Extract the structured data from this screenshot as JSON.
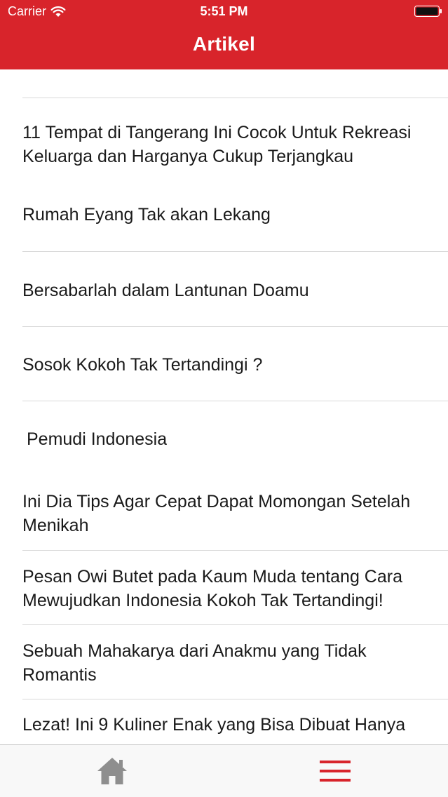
{
  "status_bar": {
    "carrier": "Carrier",
    "time": "5:51 PM"
  },
  "nav": {
    "title": "Artikel"
  },
  "articles": [
    {
      "title": "11 Tempat di Tangerang Ini Cocok Untuk Rekreasi Keluarga dan Harganya Cukup Terjangkau"
    },
    {
      "title": "Rumah Eyang Tak akan Lekang"
    },
    {
      "title": "Bersabarlah dalam Lantunan Doamu"
    },
    {
      "title": "Sosok Kokoh Tak Tertandingi ?"
    },
    {
      "title": "Pemudi Indonesia"
    },
    {
      "title": "Ini Dia Tips Agar Cepat Dapat Momongan Setelah Menikah"
    },
    {
      "title": "Pesan Owi Butet pada Kaum Muda tentang Cara Mewujudkan Indonesia Kokoh Tak Tertandingi!"
    },
    {
      "title": "Sebuah Mahakarya dari Anakmu yang Tidak Romantis"
    },
    {
      "title": "Lezat! Ini 9 Kuliner Enak yang Bisa Dibuat Hanya"
    }
  ],
  "tabbar": {
    "home_icon": "home-icon",
    "menu_icon": "hamburger-menu-icon"
  },
  "colors": {
    "header_bg": "#d8242b",
    "menu_icon": "#d8242b",
    "home_icon": "#8e8e8e"
  }
}
